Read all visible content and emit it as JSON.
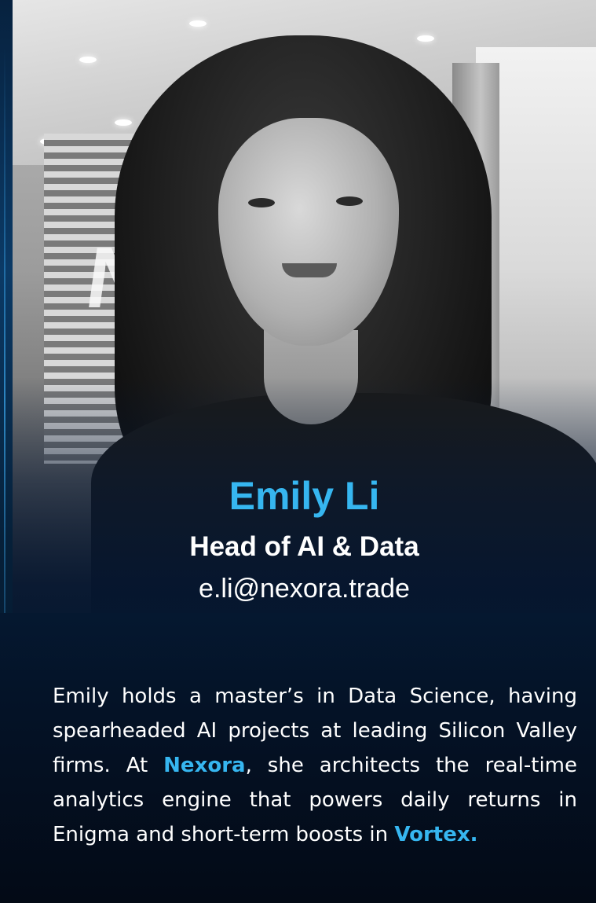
{
  "profile": {
    "name": "Emily Li",
    "title": "Head of AI & Data",
    "email": "e.li@nexora.trade"
  },
  "bio": {
    "part1": "Emily holds a master’s in Data Science, having spearheaded AI projects at leading Silicon Valley firms. At ",
    "link1": "Nexora",
    "part2": ", she architects the real-time analytics engine that powers daily returns in Enigma and short-term boosts in ",
    "link2": "Vortex."
  },
  "colors": {
    "accent": "#36b6f0",
    "background": "#030a16",
    "text": "#ffffff"
  },
  "icons": {
    "photo": "portrait-photo"
  }
}
